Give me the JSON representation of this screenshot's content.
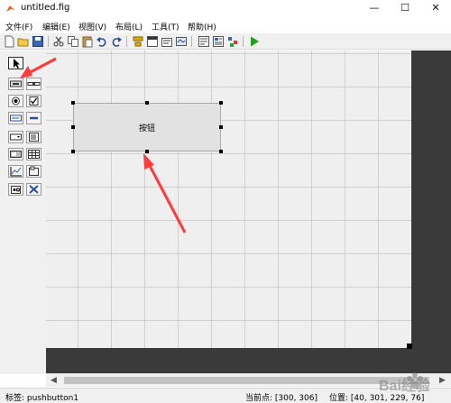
{
  "window": {
    "title": "untitled.fig",
    "minimize_glyph": "—",
    "maximize_glyph": "☐",
    "close_glyph": "✕"
  },
  "menu": {
    "items": [
      {
        "label": "文件(F)"
      },
      {
        "label": "编辑(E)"
      },
      {
        "label": "视图(V)"
      },
      {
        "label": "布局(L)"
      },
      {
        "label": "工具(T)"
      },
      {
        "label": "帮助(H)"
      }
    ]
  },
  "toolbar": {
    "icons": [
      "new-file-icon",
      "open-folder-icon",
      "save-icon",
      "cut-icon",
      "copy-icon",
      "paste-icon",
      "undo-icon",
      "redo-icon",
      "align-icon",
      "menu-editor-icon",
      "tab-order-icon",
      "toolbar-editor-icon",
      "editor-icon",
      "property-inspector-icon",
      "object-browser-icon",
      "run-icon"
    ],
    "run_color": "#1aa31a"
  },
  "palette": {
    "tools": [
      "select-tool-icon",
      "pushbutton-tool-icon",
      "slider-tool-icon",
      "radio-button-tool-icon",
      "checkbox-tool-icon",
      "edit-text-tool-icon",
      "static-text-tool-icon",
      "popup-menu-tool-icon",
      "listbox-tool-icon",
      "toggle-button-tool-icon",
      "table-tool-icon",
      "axes-tool-icon",
      "panel-tool-icon",
      "button-group-tool-icon",
      "activex-tool-icon"
    ]
  },
  "canvas": {
    "pushbutton_label": "按钮"
  },
  "annotation": {
    "arrow_color": "#ff3b3b"
  },
  "status": {
    "tag": "标签: pushbutton1",
    "current_point": "当前点:  [300, 306]",
    "position": "位置: [40, 301, 229, 76]"
  },
  "watermark": {
    "text": "Bai经验"
  }
}
